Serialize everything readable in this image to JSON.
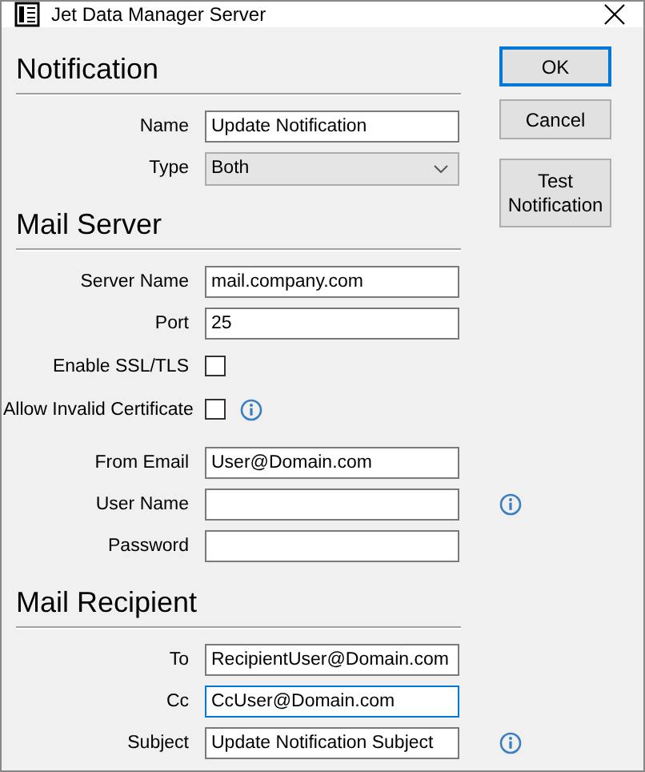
{
  "window": {
    "title": "Jet Data Manager Server"
  },
  "buttons": [
    {
      "label": "OK",
      "default": true
    },
    {
      "label": "Cancel",
      "default": false
    },
    {
      "label": "Test Notification",
      "default": false
    }
  ],
  "sections": [
    {
      "heading": "Notification",
      "rows": [
        {
          "kind": "text",
          "label": "Name",
          "value": "Update Notification"
        },
        {
          "kind": "select",
          "label": "Type",
          "value": "Both"
        }
      ]
    },
    {
      "heading": "Mail Server",
      "rows": [
        {
          "kind": "text",
          "label": "Server Name",
          "value": "mail.company.com"
        },
        {
          "kind": "text",
          "label": "Port",
          "value": "25"
        },
        {
          "kind": "checkbox",
          "label": "Enable SSL/TLS",
          "checked": false
        },
        {
          "kind": "checkbox",
          "label": "Allow Invalid Certificate",
          "checked": false,
          "info": true
        },
        {
          "kind": "text",
          "label": "From Email",
          "value": "User@Domain.com"
        },
        {
          "kind": "text",
          "label": "User Name",
          "info": true
        },
        {
          "kind": "text",
          "label": "Password"
        }
      ]
    },
    {
      "heading": "Mail Recipient",
      "rows": [
        {
          "kind": "text",
          "label": "To",
          "value": "RecipientUser@Domain.com"
        },
        {
          "kind": "text",
          "label": "Cc",
          "value": "CcUser@Domain.com",
          "focused": true
        },
        {
          "kind": "text",
          "label": "Subject",
          "value": "Update Notification Subject",
          "info": true
        }
      ]
    }
  ]
}
